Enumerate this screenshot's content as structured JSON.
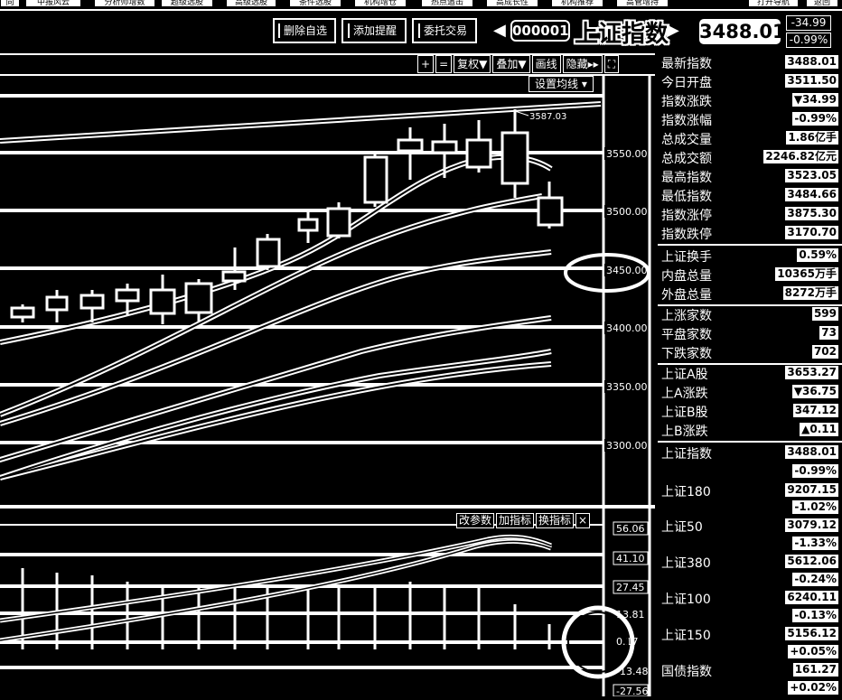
{
  "top_tabs": [
    "向",
    "中报风云",
    "分析师增数",
    "超级选股",
    "高级选股",
    "条件选股",
    "机构增仓",
    "热点追击",
    "高成长性",
    "机构推荐",
    "高管增持",
    "打开导航",
    "返回"
  ],
  "toolbar": {
    "delete_watch": "删除自选",
    "add_alert": "添加提醒",
    "delegate_trade": "委托交易",
    "stock_code": "000001",
    "index_name": "上证指数",
    "price": "3488.01",
    "change": "-34.99",
    "change_pct": "-0.99%"
  },
  "chart_tools": {
    "plus": "+",
    "equal": "=",
    "fuquan": "复权",
    "overlay": "叠加",
    "draw": "画线",
    "hide": "隐藏",
    "setma": "设置均线"
  },
  "price_axis": [
    "3550.00",
    "3500.00",
    "3450.00",
    "3400.00",
    "3350.00",
    "3300.00"
  ],
  "high_marker": "3587.03",
  "indicator_buttons": {
    "change_params": "改参数",
    "add_indicator": "加指标",
    "switch_indicator": "换指标",
    "close": "×"
  },
  "indicator_axis": [
    "56.06",
    "41.10",
    "27.45",
    "13.81",
    "0.17",
    "-13.48",
    "-27.56"
  ],
  "quote": [
    {
      "label": "最新指数",
      "value": "3488.01"
    },
    {
      "label": "今日开盘",
      "value": "3511.50"
    },
    {
      "label": "指数涨跌",
      "value": "▼34.99"
    },
    {
      "label": "指数涨幅",
      "value": "-0.99%"
    },
    {
      "label": "总成交量",
      "value": "1.86亿手"
    },
    {
      "label": "总成交额",
      "value": "2246.82亿元"
    },
    {
      "label": "最高指数",
      "value": "3523.05"
    },
    {
      "label": "最低指数",
      "value": "3484.66"
    },
    {
      "label": "指数涨停",
      "value": "3875.30"
    },
    {
      "label": "指数跌停",
      "value": "3170.70"
    },
    {
      "label": "上证换手",
      "value": "0.59%"
    },
    {
      "label": "内盘总量",
      "value": "10365万手"
    },
    {
      "label": "外盘总量",
      "value": "8272万手"
    },
    {
      "label": "上涨家数",
      "value": "599"
    },
    {
      "label": "平盘家数",
      "value": "73"
    },
    {
      "label": "下跌家数",
      "value": "702"
    },
    {
      "label": "上证A股",
      "value": "3653.27"
    },
    {
      "label": "上A涨跌",
      "value": "▼36.75"
    },
    {
      "label": "上证B股",
      "value": "347.12"
    },
    {
      "label": "上B涨跌",
      "value": "▲0.11"
    }
  ],
  "index_list": [
    {
      "label": "上证指数",
      "value": "3488.01",
      "pct": "-0.99%"
    },
    {
      "label": "上证180",
      "value": "9207.15",
      "pct": "-1.02%"
    },
    {
      "label": "上证50",
      "value": "3079.12",
      "pct": "-1.33%"
    },
    {
      "label": "上证380",
      "value": "5612.06",
      "pct": "-0.24%"
    },
    {
      "label": "上证100",
      "value": "6240.11",
      "pct": "-0.13%"
    },
    {
      "label": "上证150",
      "value": "5156.12",
      "pct": "+0.05%"
    },
    {
      "label": "国债指数",
      "value": "161.27",
      "pct": "+0.02%"
    }
  ]
}
